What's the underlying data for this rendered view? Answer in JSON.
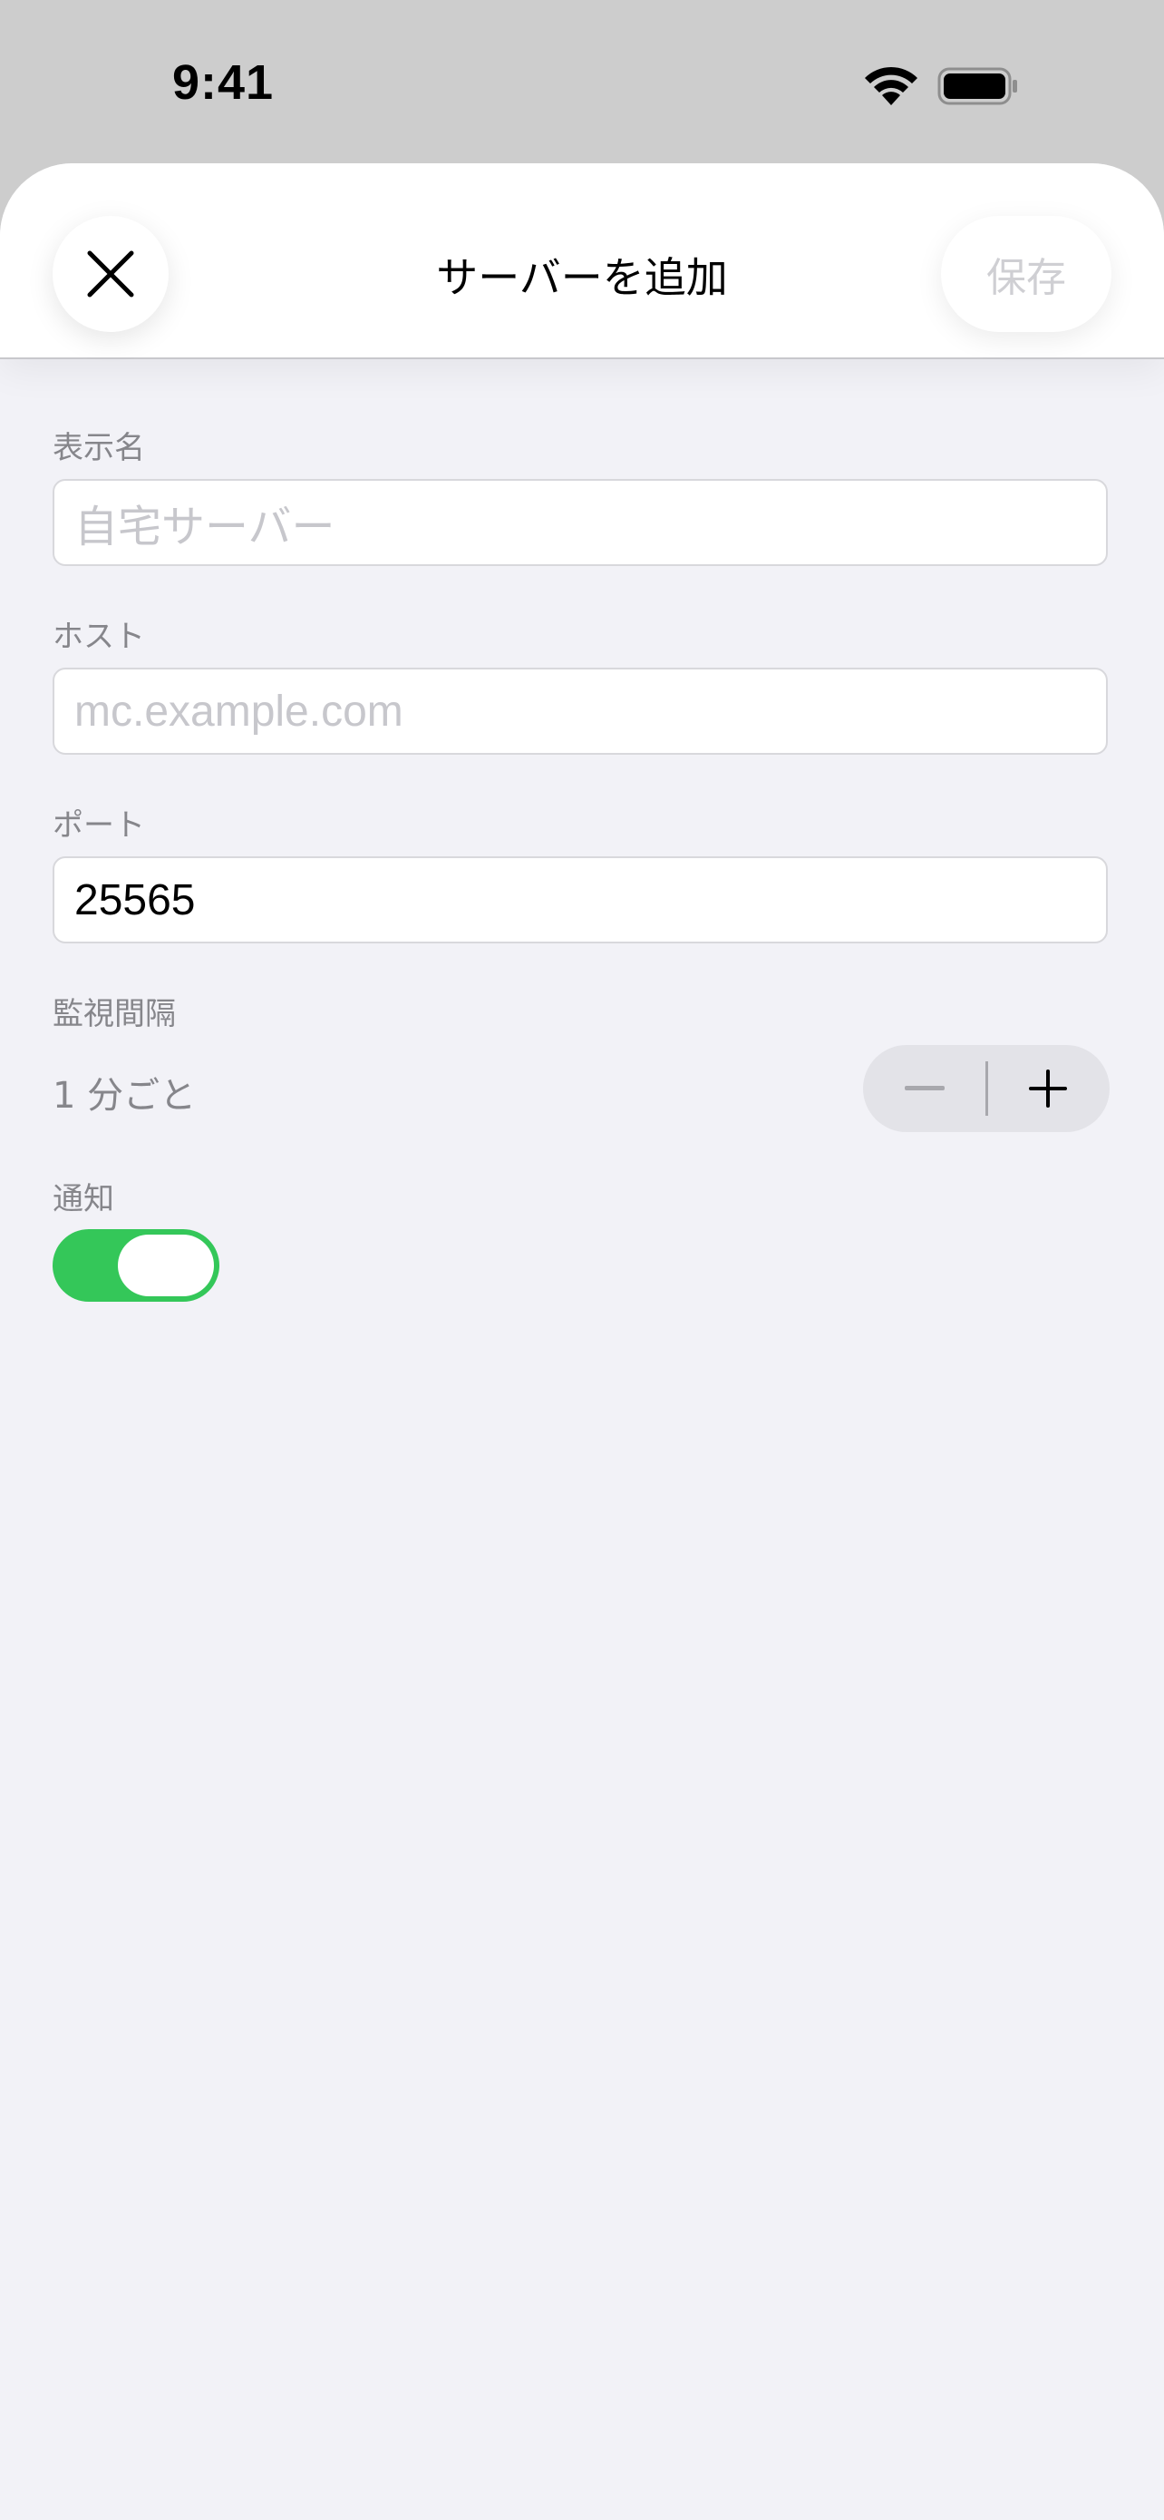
{
  "status_bar": {
    "time": "9:41",
    "icons": [
      "wifi-icon",
      "battery-icon"
    ]
  },
  "header": {
    "title": "サーバーを追加",
    "close_icon": "close-icon",
    "save_label": "保存"
  },
  "form": {
    "display_name": {
      "label": "表示名",
      "value": "",
      "placeholder": "自宅サーバー"
    },
    "host": {
      "label": "ホスト",
      "value": "",
      "placeholder": "mc.example.com"
    },
    "port": {
      "label": "ポート",
      "value": "25565"
    },
    "interval": {
      "label": "監視間隔",
      "value": "1 分ごと",
      "minus_icon": "minus-icon",
      "plus_icon": "plus-icon"
    },
    "notifications": {
      "label": "通知",
      "enabled": true
    }
  },
  "colors": {
    "accent_green": "#34c759",
    "background": "#f2f2f7",
    "label_gray": "#86868b",
    "placeholder": "#c7c7cc"
  }
}
